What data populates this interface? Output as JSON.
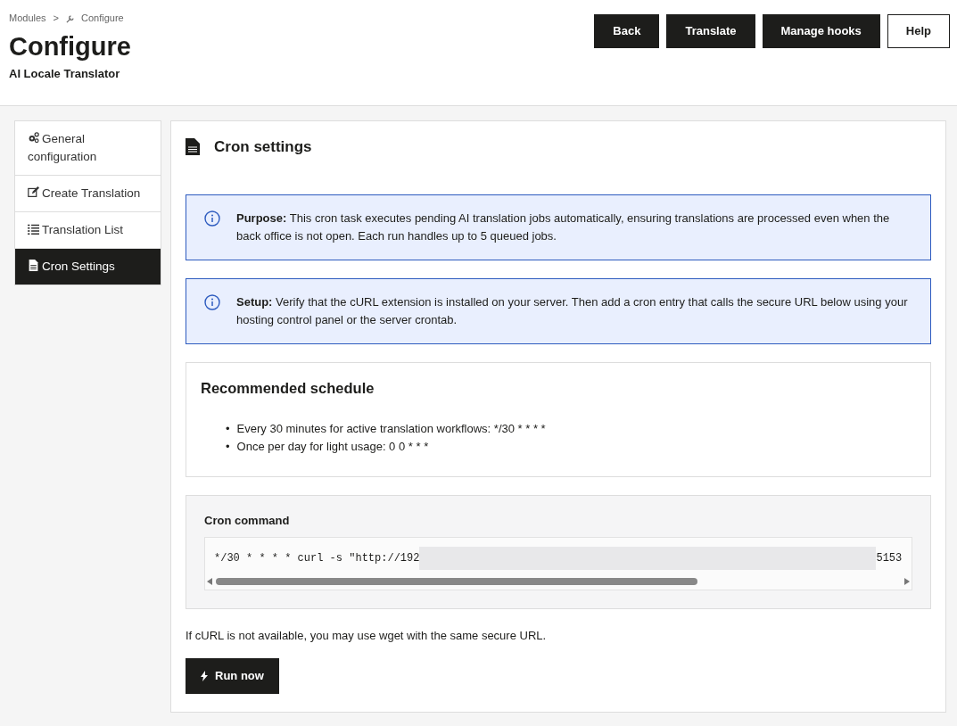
{
  "breadcrumb": {
    "items": [
      "Modules",
      "Configure"
    ],
    "separator": ">"
  },
  "page": {
    "title": "Configure",
    "subtitle": "AI Locale Translator"
  },
  "toolbar": [
    {
      "label": "Back",
      "kind": "dark"
    },
    {
      "label": "Translate",
      "kind": "dark"
    },
    {
      "label": "Manage hooks",
      "kind": "dark"
    },
    {
      "label": "Help",
      "kind": "outline"
    }
  ],
  "sidebar": {
    "items": [
      {
        "label": "General configuration",
        "kind": "gears",
        "selected": false
      },
      {
        "label": "Create Translation",
        "kind": "edit",
        "selected": false
      },
      {
        "label": "Translation List",
        "kind": "list",
        "selected": false
      },
      {
        "label": "Cron Settings",
        "kind": "file",
        "selected": true
      }
    ]
  },
  "panel": {
    "title": "Cron settings",
    "alerts": [
      {
        "text": "**Purpose:** This cron task executes pending AI translation jobs automatically, ensuring translations are processed even when the back office is not open. Each run handles up to 5 queued jobs."
      },
      {
        "text": "**Setup:** Verify that the cURL extension is installed on your server. Then add a cron entry that calls the secure URL below using your hosting control panel or the server crontab."
      }
    ],
    "schedule": {
      "title": "Recommended schedule",
      "bullet": "•",
      "items": [
        "Every 30 minutes for active translation workflows: */30 * * * *",
        "Once per day for light usage: 0 0 * * *"
      ]
    },
    "command": {
      "label": "Cron command",
      "start": "*/30 * * * * curl -s \"http://192",
      "end": "5153"
    },
    "note": "If cURL is not available, you may use wget with the same secure URL.",
    "run_button": "Run now"
  }
}
